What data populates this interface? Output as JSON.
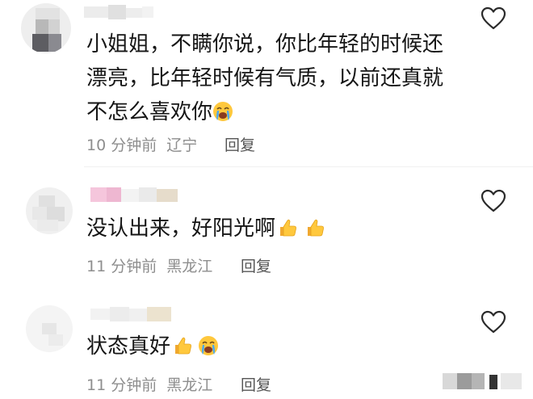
{
  "comments": [
    {
      "text_lines": [
        "小姐姐，不瞒你说，你比年轻的时候还",
        "漂亮，比年轻时候有气质，以前还真就",
        "不怎么喜欢你"
      ],
      "emoji_after": [
        "sob-emoji"
      ],
      "time": "10 分钟前",
      "location": "辽宁",
      "reply_label": "回复",
      "like_icon": "heart-outline-icon"
    },
    {
      "text_lines": [
        "没认出来，好阳光啊"
      ],
      "emoji_after": [
        "thumbs-up-emoji",
        "thumbs-up-emoji"
      ],
      "time": "11 分钟前",
      "location": "黑龙江",
      "reply_label": "回复",
      "like_icon": "heart-outline-icon"
    },
    {
      "text_lines": [
        "状态真好"
      ],
      "emoji_after": [
        "thumbs-up-emoji",
        "sob-emoji"
      ],
      "time": "11 分钟前",
      "location": "黑龙江",
      "reply_label": "回复",
      "like_icon": "heart-outline-icon"
    }
  ]
}
